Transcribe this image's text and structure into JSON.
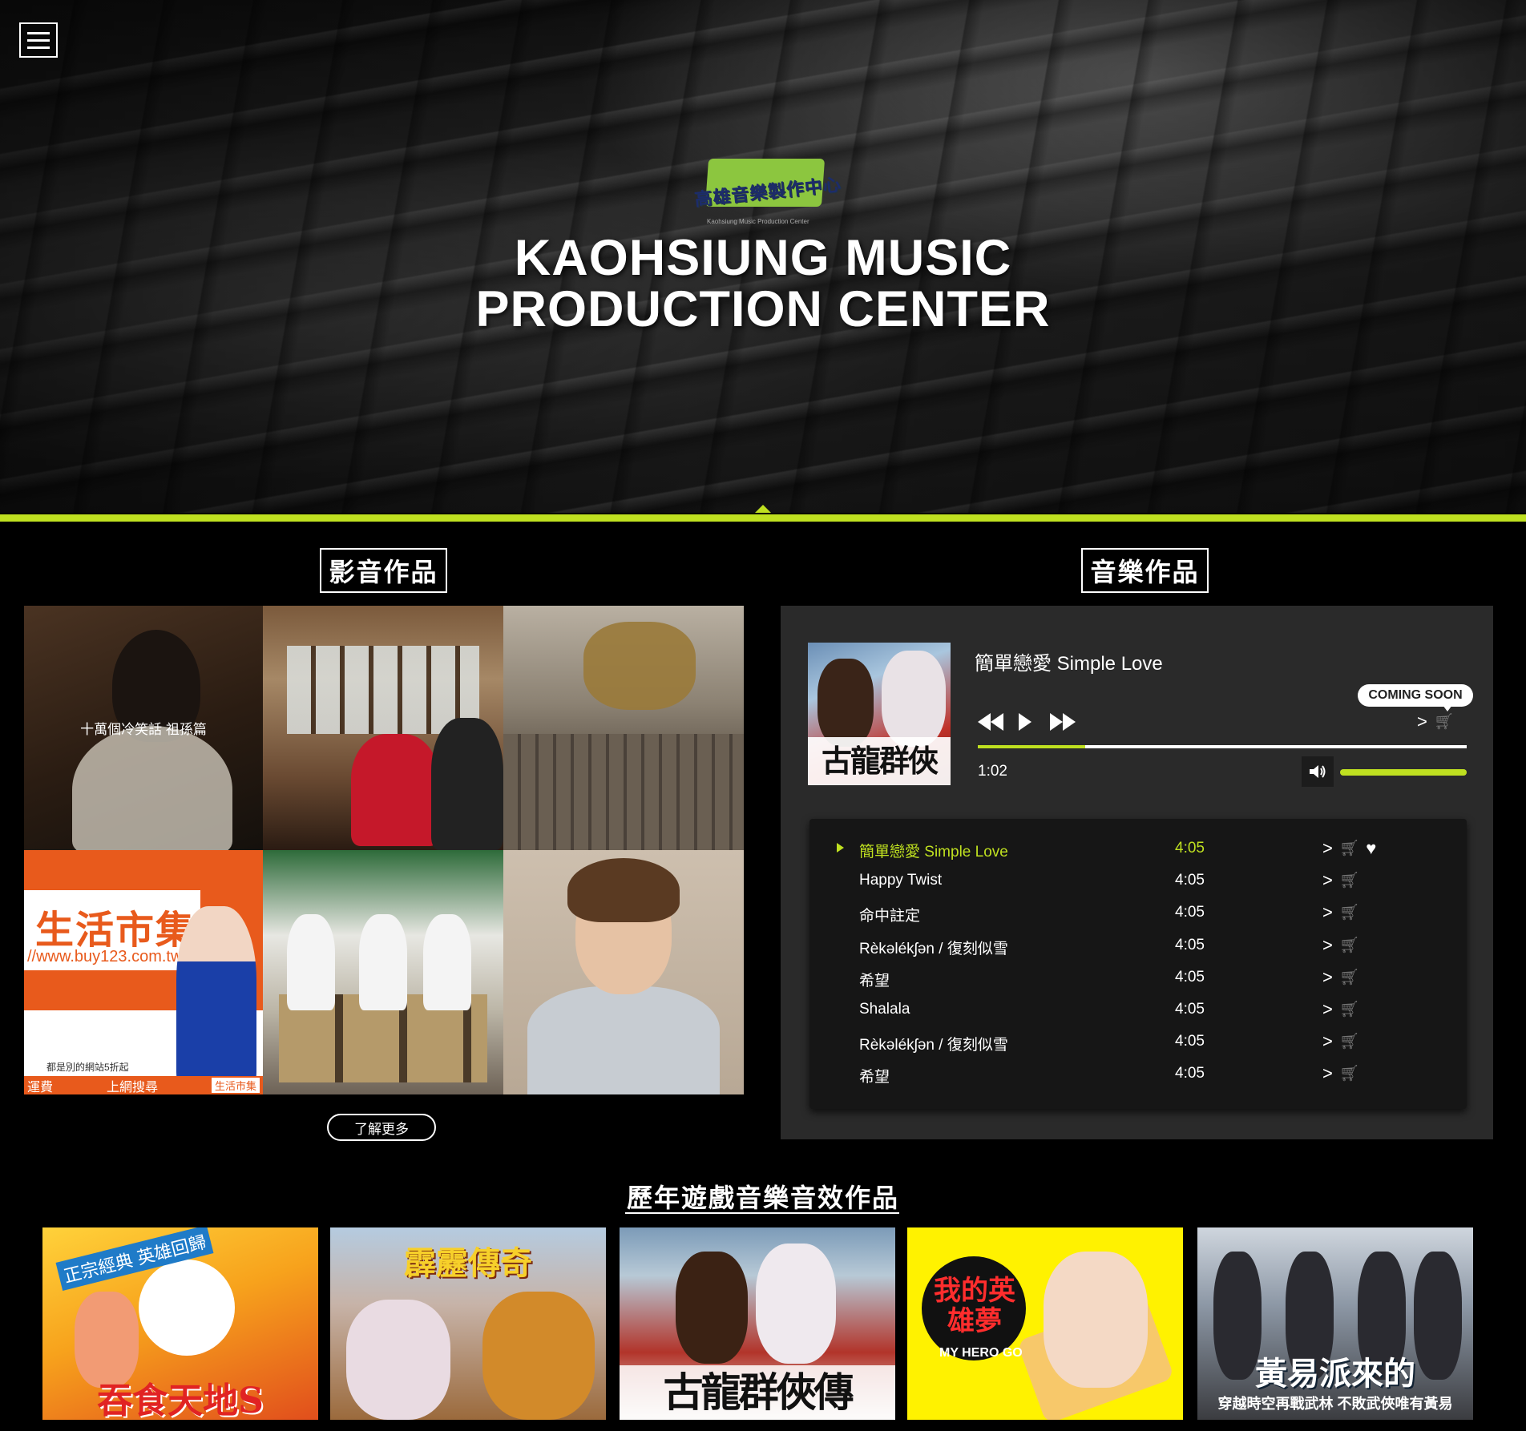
{
  "hero": {
    "logo_text": "高雄音樂製作中心",
    "logo_subtext": "Kaohsiung Music Production Center",
    "title_line1": "KAOHSIUNG MUSIC",
    "title_line2": "PRODUCTION CENTER",
    "accent_color": "#bfe020"
  },
  "video_section": {
    "title": "影音作品",
    "tiles": [
      {
        "caption": "十萬個冷笑話 祖孫篇"
      },
      {
        "caption": ""
      },
      {
        "caption": ""
      },
      {
        "sign_text": "生活市集",
        "url_text": "//www.buy123.com.tw",
        "fine_print": "都是別的網站5折起",
        "strip_left": "運費",
        "strip_mid": "上網搜尋",
        "strip_tag": "生活市集"
      },
      {
        "caption": ""
      },
      {
        "caption": ""
      }
    ],
    "more_button": "了解更多"
  },
  "music_section": {
    "title": "音樂作品",
    "now_playing": {
      "title": "簡單戀愛 Simple Love",
      "cover_text": "古龍群俠傳",
      "current_time": "1:02",
      "progress_fraction": 0.22,
      "volume_fraction": 1.0,
      "badge": "COMING SOON"
    },
    "playlist": [
      {
        "name": "簡單戀愛 Simple Love",
        "duration": "4:05",
        "active": true
      },
      {
        "name": "Happy Twist",
        "duration": "4:05"
      },
      {
        "name": "命中註定",
        "duration": "4:05"
      },
      {
        "name": "Rèkəlékʃən / 復刻似雪",
        "duration": "4:05"
      },
      {
        "name": "希望",
        "duration": "4:05"
      },
      {
        "name": "Shalala",
        "duration": "4:05"
      },
      {
        "name": "Rèkəlékʃən / 復刻似雪",
        "duration": "4:05"
      },
      {
        "name": "希望",
        "duration": "4:05"
      }
    ]
  },
  "games_section": {
    "title": "歷年遊戲音樂音效作品",
    "games": [
      {
        "title": "吞食天地S",
        "tag": "正宗經典 英雄回歸"
      },
      {
        "title": "霹靂傳奇"
      },
      {
        "title": "古龍群俠傳"
      },
      {
        "title": "我的英雄夢",
        "sub": "MY HERO GO"
      },
      {
        "title": "黃易派來的",
        "sub": "穿越時空再戰武林 不敗武俠唯有黃易"
      }
    ]
  },
  "icons": {
    "menu": "hamburger-icon",
    "share": "share-icon",
    "cart": "cart-icon",
    "heart": "heart-icon",
    "volume": "volume-icon"
  }
}
